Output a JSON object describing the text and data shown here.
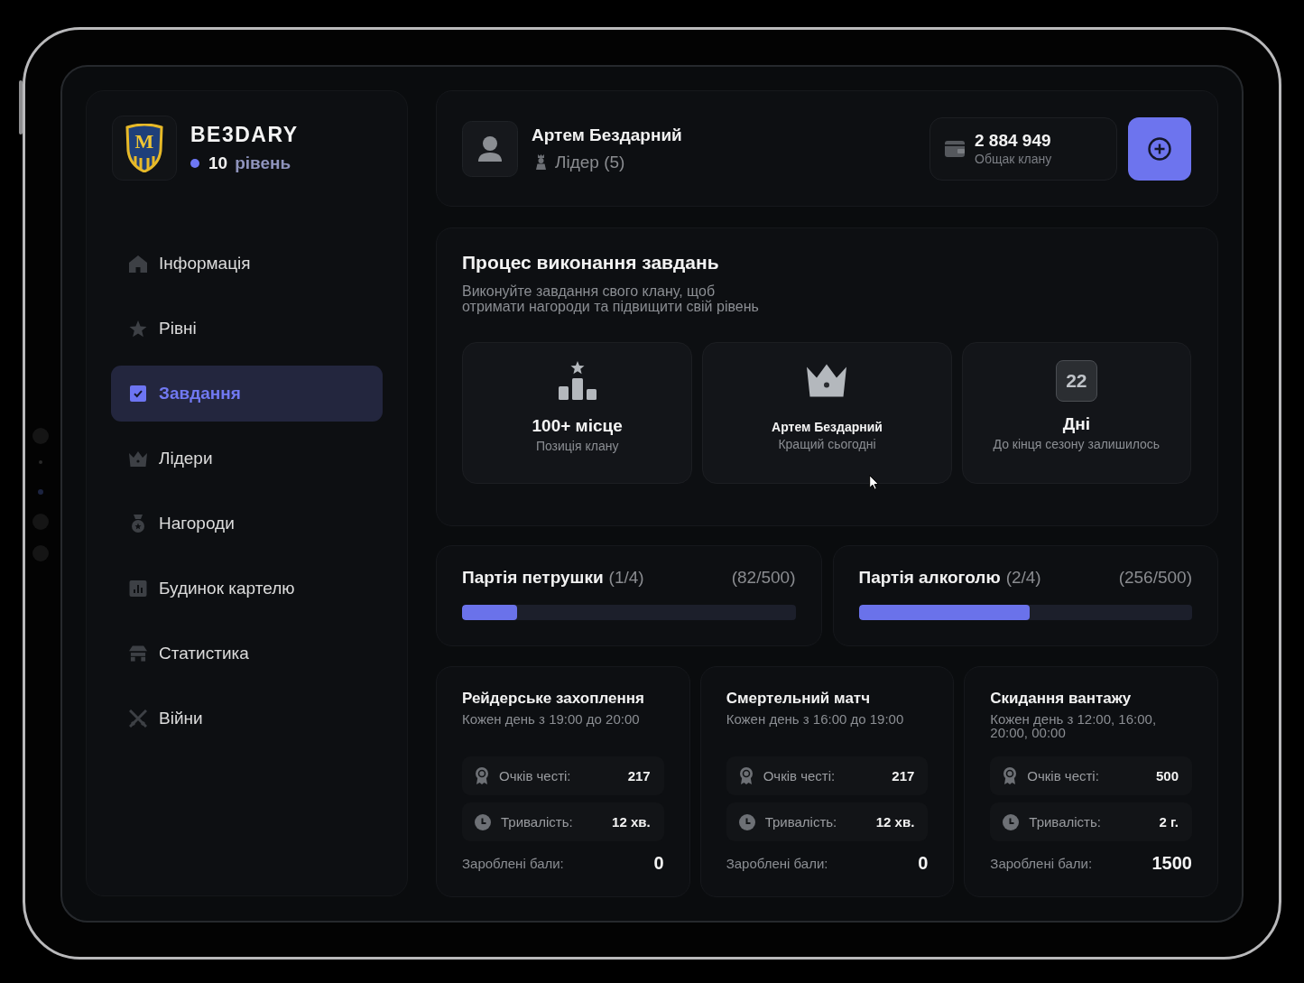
{
  "clan": {
    "logo_letter": "M",
    "name": "BE3DARY",
    "level": "10",
    "level_label": "рівень"
  },
  "menu": [
    {
      "label": "Інформація",
      "selected": false
    },
    {
      "label": "Рівні",
      "selected": false
    },
    {
      "label": "Завдання",
      "selected": true
    },
    {
      "label": "Лідери",
      "selected": false
    },
    {
      "label": "Нагороди",
      "selected": false
    },
    {
      "label": "Будинок картелю",
      "selected": false
    },
    {
      "label": "Статистика",
      "selected": false
    },
    {
      "label": "Війни",
      "selected": false
    }
  ],
  "header": {
    "user": {
      "name": "Артем Бездарний",
      "role": "Лідер (5)"
    },
    "balance": {
      "amount": "2 884 949",
      "label": "Общак клану"
    }
  },
  "progress": {
    "title": "Процес виконання завдань",
    "description": "Виконуйте завдання свого клану, щоб отримати нагороди та підвищити свій рівень",
    "stats": [
      {
        "kind": "place",
        "value": "100+ місце",
        "label": "Позиція клану"
      },
      {
        "kind": "best",
        "value": "Артем Бездарний",
        "label": "Кращий сьогодні"
      },
      {
        "kind": "days",
        "badge": "22",
        "value": "Дні",
        "label": "До кінця сезону залишилось"
      }
    ]
  },
  "parties": [
    {
      "name": "Партія петрушки",
      "stage": "(1/4)",
      "count": "(82/500)",
      "level": 0.164
    },
    {
      "name": "Партія алкоголю",
      "stage": "(2/4)",
      "count": "(256/500)",
      "level": 0.512
    }
  ],
  "tasks": [
    {
      "title": "Рейдерське захоплення",
      "schedule": "Кожен день з 19:00 до 20:00",
      "rows": [
        {
          "kind": "honor",
          "label": "Очків честі:",
          "value": "217"
        },
        {
          "kind": "duration",
          "label": "Тривалість:",
          "value": "12 хв."
        }
      ],
      "earned_label": "Зароблені бали:",
      "earned": "0"
    },
    {
      "title": "Смертельний матч",
      "schedule": "Кожен день з 16:00 до 19:00",
      "rows": [
        {
          "kind": "honor",
          "label": "Очків честі:",
          "value": "217"
        },
        {
          "kind": "duration",
          "label": "Тривалість:",
          "value": "12 хв."
        }
      ],
      "earned_label": "Зароблені бали:",
      "earned": "0"
    },
    {
      "title": "Скидання вантажу",
      "schedule": "Кожен день з 12:00, 16:00, 20:00, 00:00",
      "rows": [
        {
          "kind": "honor",
          "label": "Очків честі:",
          "value": "500"
        },
        {
          "kind": "duration",
          "label": "Тривалість:",
          "value": "2 г."
        }
      ],
      "earned_label": "Зароблені бали:",
      "earned": "1500"
    }
  ]
}
